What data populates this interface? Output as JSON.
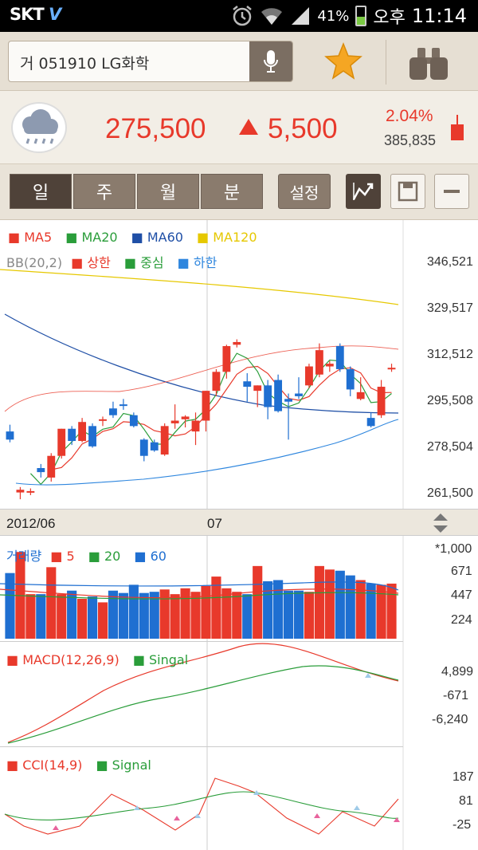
{
  "statusbar": {
    "carrier": "SKT",
    "battery_pct": "41%",
    "ampm": "오후",
    "time": "11:14"
  },
  "search": {
    "value": "거 051910 LG화학"
  },
  "quote": {
    "price": "275,500",
    "change": "5,500",
    "change_pct": "2.04%",
    "volume": "385,835"
  },
  "tabs": [
    {
      "label": "일"
    },
    {
      "label": "주"
    },
    {
      "label": "월"
    },
    {
      "label": "분"
    }
  ],
  "setting_label": "설정",
  "legend1": {
    "ma5": "MA5",
    "ma20": "MA20",
    "ma60": "MA60",
    "ma120": "MA120",
    "bb": "BB(20,2)",
    "upper": "상한",
    "middle": "중심",
    "lower": "하한"
  },
  "price_axis": [
    "346,521",
    "329,517",
    "312,512",
    "295,508",
    "278,504",
    "261,500"
  ],
  "dates": {
    "left": "2012/06",
    "mid": "07"
  },
  "volume_legend": {
    "title": "거래량",
    "ma5": "5",
    "ma20": "20",
    "ma60": "60"
  },
  "volume_axis": [
    "*1,000",
    "671",
    "447",
    "224"
  ],
  "macd_legend": {
    "macd": "MACD(12,26,9)",
    "signal": "Singal"
  },
  "macd_axis": [
    "4,899",
    "-671",
    "-6,240"
  ],
  "cci_legend": {
    "cci": "CCI(14,9)",
    "signal": "Signal"
  },
  "cci_axis": [
    "187",
    "81",
    "-25"
  ],
  "colors": {
    "up": "#e8392b",
    "down": "#1f6fd1",
    "ma5": "#e8392b",
    "ma20": "#2a9d3a",
    "ma60": "#1f4fa6",
    "ma120": "#e6c800",
    "bb_lower": "#2e86de"
  },
  "chart_data": {
    "type": "candlestick",
    "candles": [
      {
        "o": 285000,
        "h": 287500,
        "l": 281000,
        "c": 282000
      },
      {
        "o": 262500,
        "h": 264500,
        "l": 260000,
        "c": 263500
      },
      {
        "o": 263000,
        "h": 264000,
        "l": 261500,
        "c": 263000
      },
      {
        "o": 271500,
        "h": 273000,
        "l": 268000,
        "c": 270000
      },
      {
        "o": 268000,
        "h": 277000,
        "l": 266500,
        "c": 276000
      },
      {
        "o": 276000,
        "h": 286000,
        "l": 275000,
        "c": 286000
      },
      {
        "o": 286000,
        "h": 287000,
        "l": 280000,
        "c": 281500
      },
      {
        "o": 281500,
        "h": 290000,
        "l": 281000,
        "c": 288500
      },
      {
        "o": 287000,
        "h": 288000,
        "l": 279000,
        "c": 279500
      },
      {
        "o": 289000,
        "h": 290500,
        "l": 287000,
        "c": 289500
      },
      {
        "o": 293500,
        "h": 296000,
        "l": 290000,
        "c": 291000
      },
      {
        "o": 295000,
        "h": 297000,
        "l": 293000,
        "c": 294500
      },
      {
        "o": 291000,
        "h": 292000,
        "l": 286500,
        "c": 287000
      },
      {
        "o": 282000,
        "h": 282500,
        "l": 274000,
        "c": 276000
      },
      {
        "o": 281000,
        "h": 282000,
        "l": 277500,
        "c": 278000
      },
      {
        "o": 276500,
        "h": 288000,
        "l": 276000,
        "c": 287000
      },
      {
        "o": 288000,
        "h": 295000,
        "l": 286000,
        "c": 289000
      },
      {
        "o": 289500,
        "h": 291000,
        "l": 286500,
        "c": 290500
      },
      {
        "o": 285000,
        "h": 292000,
        "l": 280000,
        "c": 289000
      },
      {
        "o": 289000,
        "h": 300000,
        "l": 285000,
        "c": 300000
      },
      {
        "o": 300000,
        "h": 308000,
        "l": 298000,
        "c": 307000
      },
      {
        "o": 307000,
        "h": 317000,
        "l": 304500,
        "c": 316500
      },
      {
        "o": 317000,
        "h": 319000,
        "l": 316000,
        "c": 318000
      },
      {
        "o": 303500,
        "h": 306500,
        "l": 296000,
        "c": 301500
      },
      {
        "o": 300000,
        "h": 302000,
        "l": 294000,
        "c": 302000
      },
      {
        "o": 302000,
        "h": 304000,
        "l": 289500,
        "c": 294000
      },
      {
        "o": 304000,
        "h": 306000,
        "l": 292000,
        "c": 292500
      },
      {
        "o": 297000,
        "h": 299000,
        "l": 282000,
        "c": 296000
      },
      {
        "o": 299000,
        "h": 305000,
        "l": 297000,
        "c": 298000
      },
      {
        "o": 302000,
        "h": 310000,
        "l": 301000,
        "c": 309000
      },
      {
        "o": 306000,
        "h": 317500,
        "l": 305000,
        "c": 315000
      },
      {
        "o": 309000,
        "h": 311000,
        "l": 307000,
        "c": 310000
      },
      {
        "o": 316500,
        "h": 317500,
        "l": 307000,
        "c": 308000
      },
      {
        "o": 308000,
        "h": 309000,
        "l": 298000,
        "c": 300500
      },
      {
        "o": 297000,
        "h": 305000,
        "l": 296500,
        "c": 299500
      },
      {
        "o": 290000,
        "h": 292000,
        "l": 286500,
        "c": 287000
      },
      {
        "o": 291000,
        "h": 304000,
        "l": 290000,
        "c": 301500
      },
      {
        "o": 308000,
        "h": 310000,
        "l": 307000,
        "c": 308500
      }
    ],
    "volume": [
      560,
      740,
      380,
      380,
      610,
      380,
      410,
      340,
      360,
      310,
      410,
      390,
      460,
      390,
      400,
      420,
      380,
      430,
      400,
      450,
      530,
      430,
      400,
      380,
      620,
      490,
      500,
      410,
      410,
      400,
      620,
      590,
      580,
      540,
      500,
      470,
      460,
      470
    ]
  }
}
